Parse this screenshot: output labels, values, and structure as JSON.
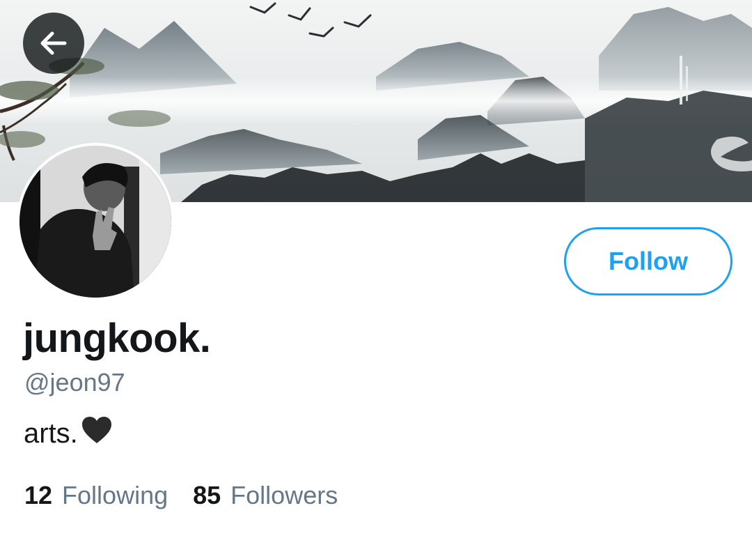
{
  "header": {
    "back_icon": "arrow-left-icon",
    "banner_image": "ink-wash mountain landscape with flying cranes"
  },
  "profile": {
    "avatar_image": "black-and-white photo of person making peace sign",
    "display_name": "jungkook.",
    "handle": "@jeon97",
    "bio": "arts.",
    "bio_icon": "black-heart-icon",
    "follow_label": "Follow"
  },
  "stats": {
    "following_count": "12",
    "following_label": "Following",
    "followers_count": "85",
    "followers_label": "Followers"
  },
  "colors": {
    "accent": "#1da1f2",
    "text": "#14171a",
    "secondary_text": "#657786"
  }
}
